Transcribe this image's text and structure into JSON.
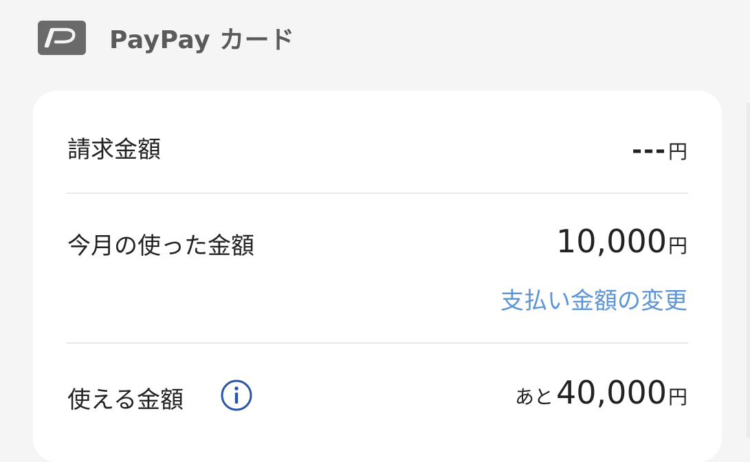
{
  "header": {
    "title": "PayPay カード",
    "logo_icon": "paypay-p-logo-icon"
  },
  "rows": {
    "billing": {
      "label": "請求金額",
      "value": "---",
      "unit": "円"
    },
    "used_this_month": {
      "label": "今月の使った金額",
      "value": "10,000",
      "unit": "円",
      "link": "支払い金額の変更"
    },
    "available": {
      "label": "使える金額",
      "prefix": "あと",
      "value": "40,000",
      "unit": "円",
      "info_icon": "info-icon"
    }
  },
  "colors": {
    "link": "#5b95d8",
    "info": "#2b55a8",
    "logo": "#6a6a6a"
  }
}
